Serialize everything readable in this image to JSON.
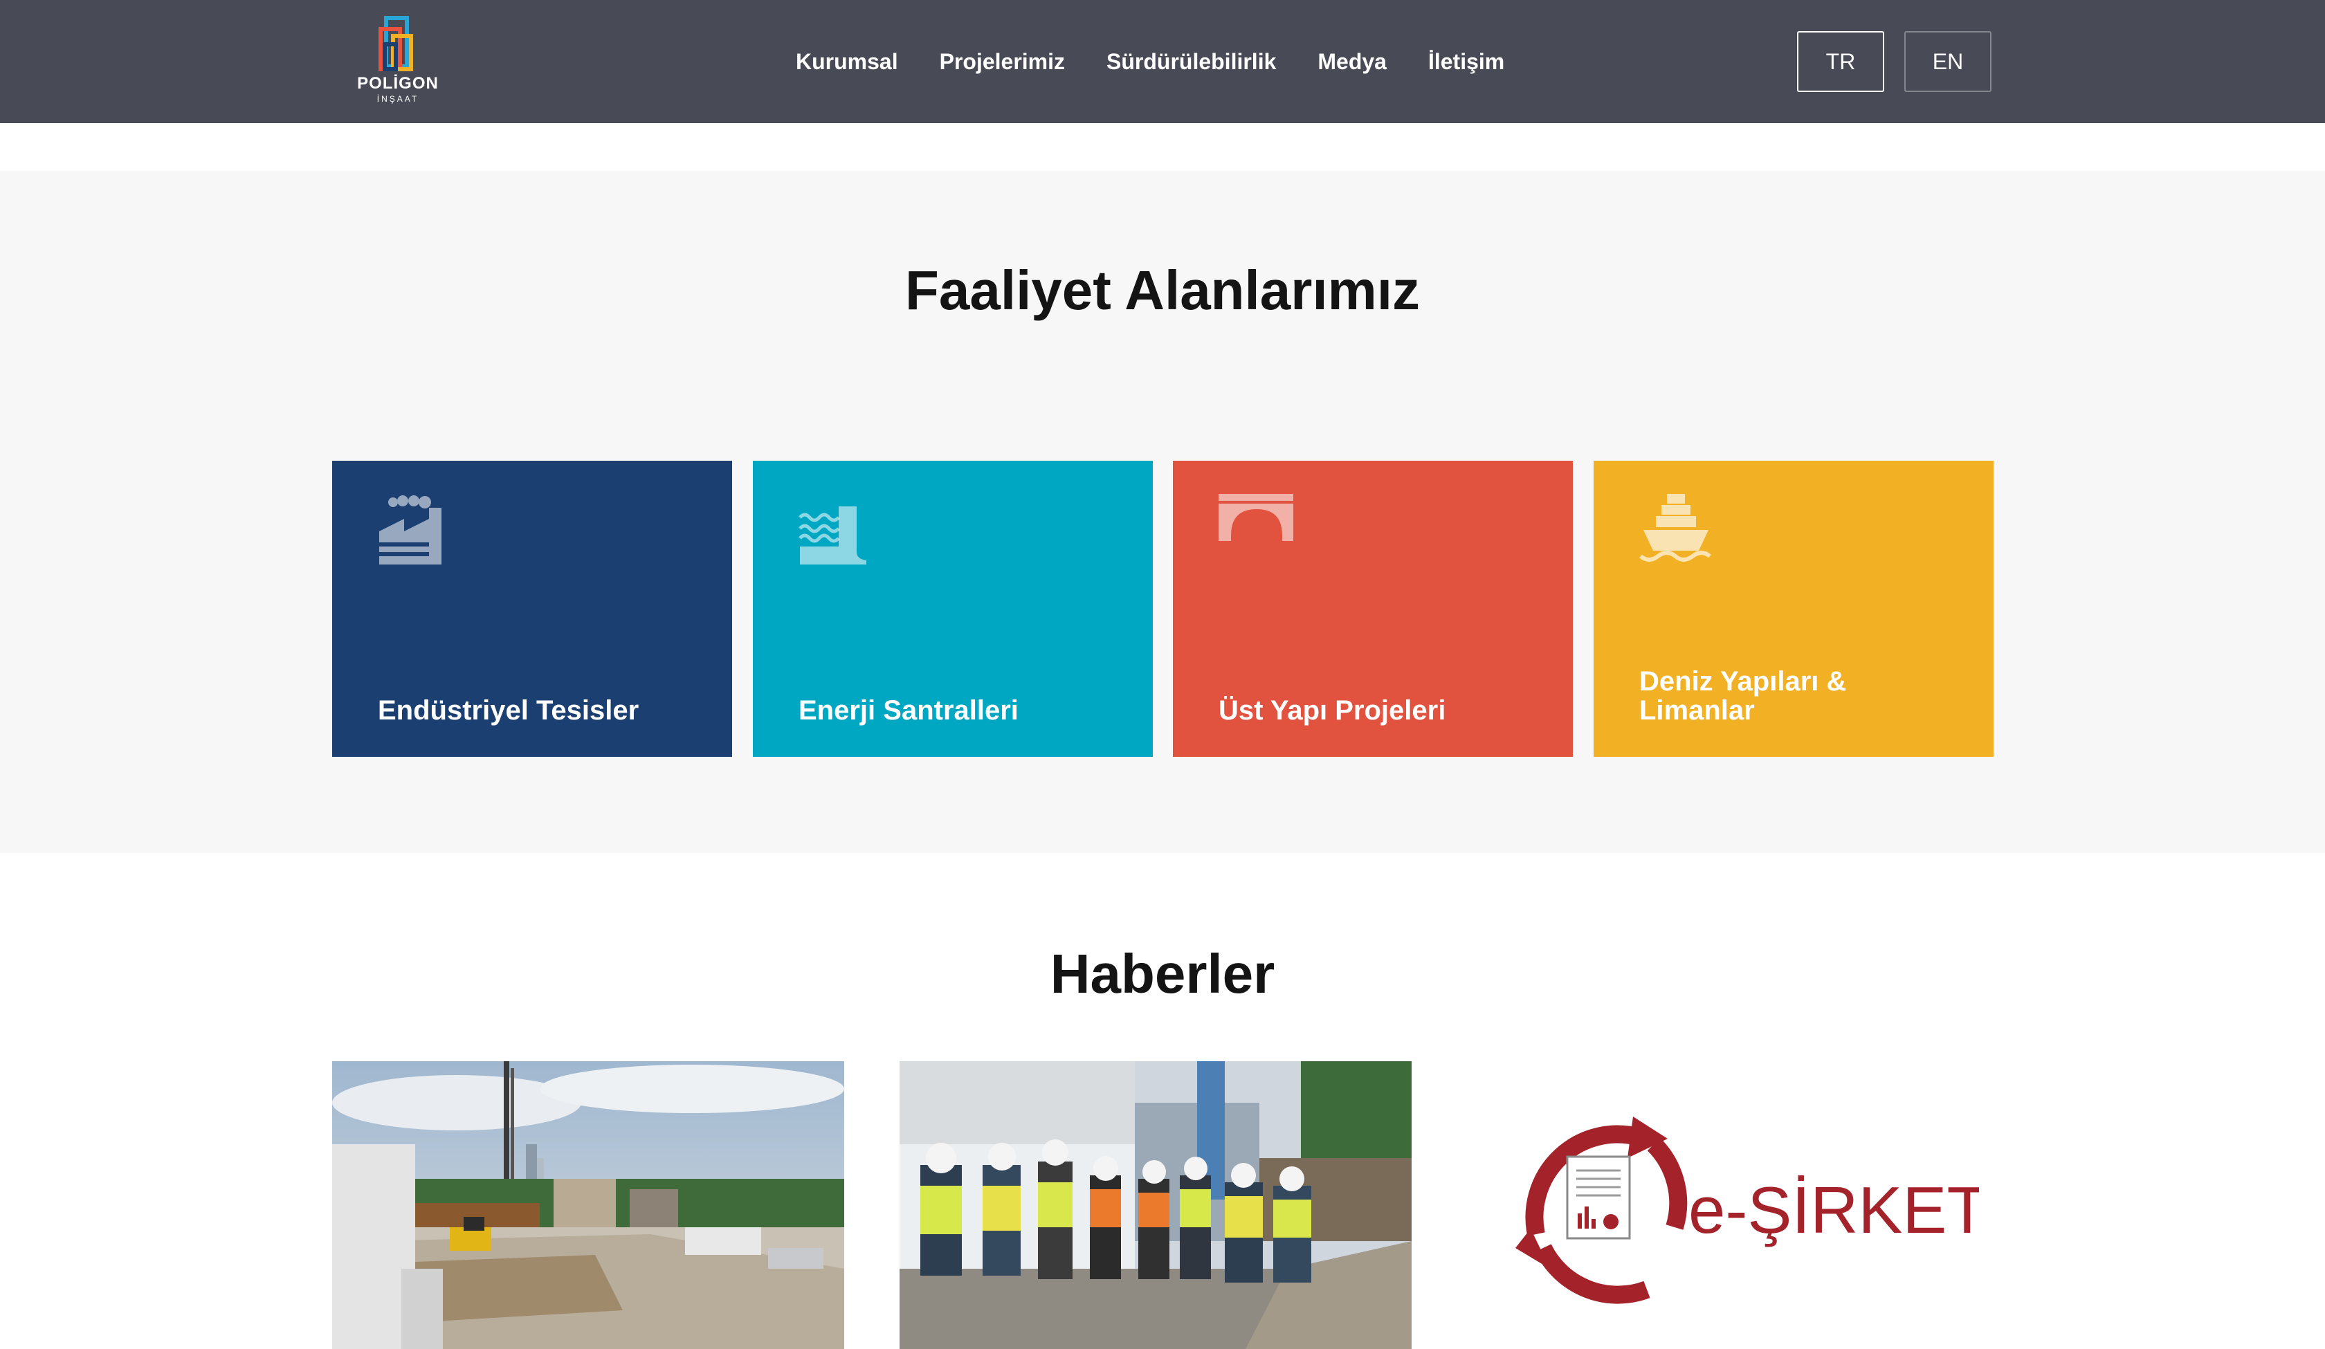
{
  "header": {
    "logo": {
      "name": "POLİGON",
      "sub": "İNŞAAT"
    },
    "nav": [
      "Kurumsal",
      "Projelerimiz",
      "Sürdürülebilirlik",
      "Medya",
      "İletişim"
    ],
    "languages": [
      "TR",
      "EN"
    ],
    "active_language": "TR"
  },
  "activities": {
    "title": "Faaliyet Alanlarımız",
    "cards": [
      {
        "label": "Endüstriyel Tesisler",
        "icon": "factory-icon",
        "color": "#1b3f70"
      },
      {
        "label": "Enerji Santralleri",
        "icon": "dam-water-icon",
        "color": "#00a7c2"
      },
      {
        "label": "Üst Yapı Projeleri",
        "icon": "bridge-arch-icon",
        "color": "#e2533f"
      },
      {
        "label": "Deniz Yapıları & Limanlar",
        "icon": "ship-icon",
        "color": "#f2b024"
      }
    ]
  },
  "news": {
    "title": "Haberler",
    "items": [
      {
        "image": "construction-site-excavation-photo"
      },
      {
        "image": "workers-site-meeting-photo"
      },
      {
        "image": "e-sirket-logo",
        "logo_text": "e-ŞİRKET"
      }
    ]
  },
  "colors": {
    "header_bg": "#484a56",
    "section_bg": "#f7f7f7",
    "e_sirket_red": "#a4232a"
  }
}
